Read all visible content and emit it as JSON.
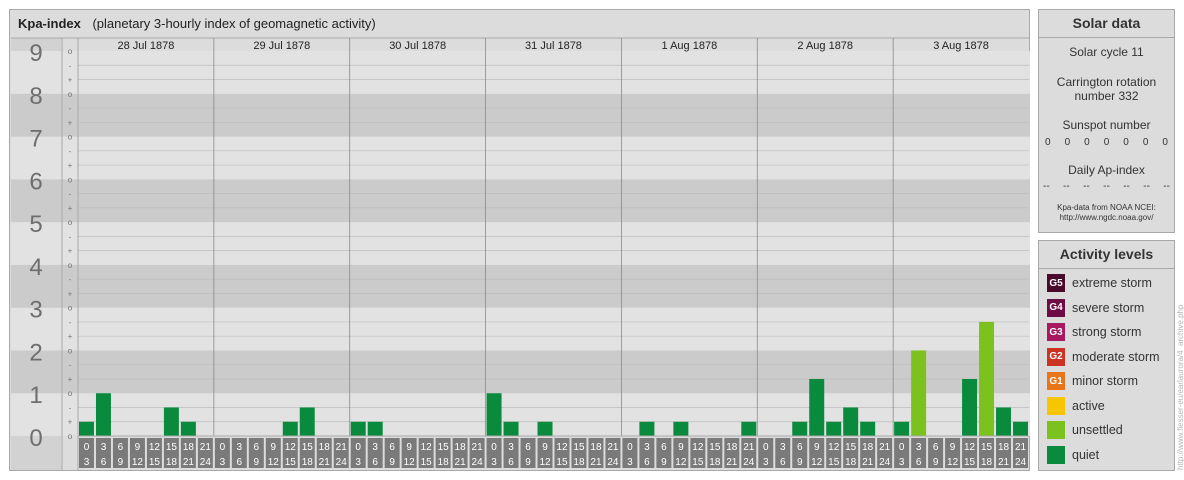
{
  "header": {
    "title": "Kpa-index",
    "subtitle": "(planetary 3-hourly index of geomagnetic activity)"
  },
  "chart_data": {
    "type": "bar",
    "title": "Kpa-index",
    "subtitle": "(planetary 3-hourly index of geomagnetic activity)",
    "ylim": [
      0,
      9
    ],
    "y_ticks": [
      "0",
      "1",
      "2",
      "3",
      "4",
      "5",
      "6",
      "7",
      "8",
      "9"
    ],
    "y_minor_ticks": [
      "+",
      "o",
      "-"
    ],
    "days": [
      "28 Jul 1878",
      "29 Jul 1878",
      "30 Jul 1878",
      "31 Jul 1878",
      "1 Aug 1878",
      "2 Aug 1878",
      "3 Aug 1878"
    ],
    "hour_bins": [
      [
        "0",
        "3"
      ],
      [
        "3",
        "6"
      ],
      [
        "6",
        "9"
      ],
      [
        "9",
        "12"
      ],
      [
        "12",
        "15"
      ],
      [
        "15",
        "18"
      ],
      [
        "18",
        "21"
      ],
      [
        "21",
        "24"
      ]
    ],
    "values": [
      [
        0.333,
        1.0,
        0,
        0,
        0,
        0.667,
        0.333,
        0
      ],
      [
        0,
        0,
        0,
        0,
        0.333,
        0.667,
        0,
        0
      ],
      [
        0.333,
        0.333,
        0,
        0,
        0,
        0,
        0,
        0
      ],
      [
        1.0,
        0.333,
        0,
        0.333,
        0,
        0,
        0,
        0
      ],
      [
        0,
        0.333,
        0,
        0.333,
        0,
        0,
        0,
        0.333
      ],
      [
        0,
        0,
        0.333,
        1.333,
        0.333,
        0.667,
        0.333,
        0
      ],
      [
        0.333,
        2.0,
        0,
        0,
        1.333,
        2.667,
        0.667,
        0.333
      ]
    ],
    "grid": true,
    "legend_position": "right"
  },
  "solar": {
    "title": "Solar data",
    "cycle": "Solar cycle 11",
    "carrington_line1": "Carrington rotation",
    "carrington_line2": "number 332",
    "sunspot_label": "Sunspot number",
    "sunspot_values": [
      "0",
      "0",
      "0",
      "0",
      "0",
      "0",
      "0"
    ],
    "ap_label": "Daily Ap-index",
    "ap_values": [
      "--",
      "--",
      "--",
      "--",
      "--",
      "--",
      "--"
    ],
    "source_line1": "Kpa-data from NOAA NCEI:",
    "source_line2": "http://www.ngdc.noaa.gov/"
  },
  "activity": {
    "title": "Activity levels",
    "levels": [
      {
        "code": "G5",
        "label": "extreme storm",
        "color": "#4a0a2a"
      },
      {
        "code": "G4",
        "label": "severe storm",
        "color": "#6e0d45"
      },
      {
        "code": "G3",
        "label": "strong storm",
        "color": "#a8185e"
      },
      {
        "code": "G2",
        "label": "moderate storm",
        "color": "#cc3322"
      },
      {
        "code": "G1",
        "label": "minor storm",
        "color": "#e87518"
      },
      {
        "code": "",
        "label": "active",
        "color": "#f7c600"
      },
      {
        "code": "",
        "label": "unsettled",
        "color": "#7cc21f"
      },
      {
        "code": "",
        "label": "quiet",
        "color": "#0a8a3c"
      }
    ]
  },
  "credit": "http://www.fiesser-eu/earlaurora/4_archive.php"
}
